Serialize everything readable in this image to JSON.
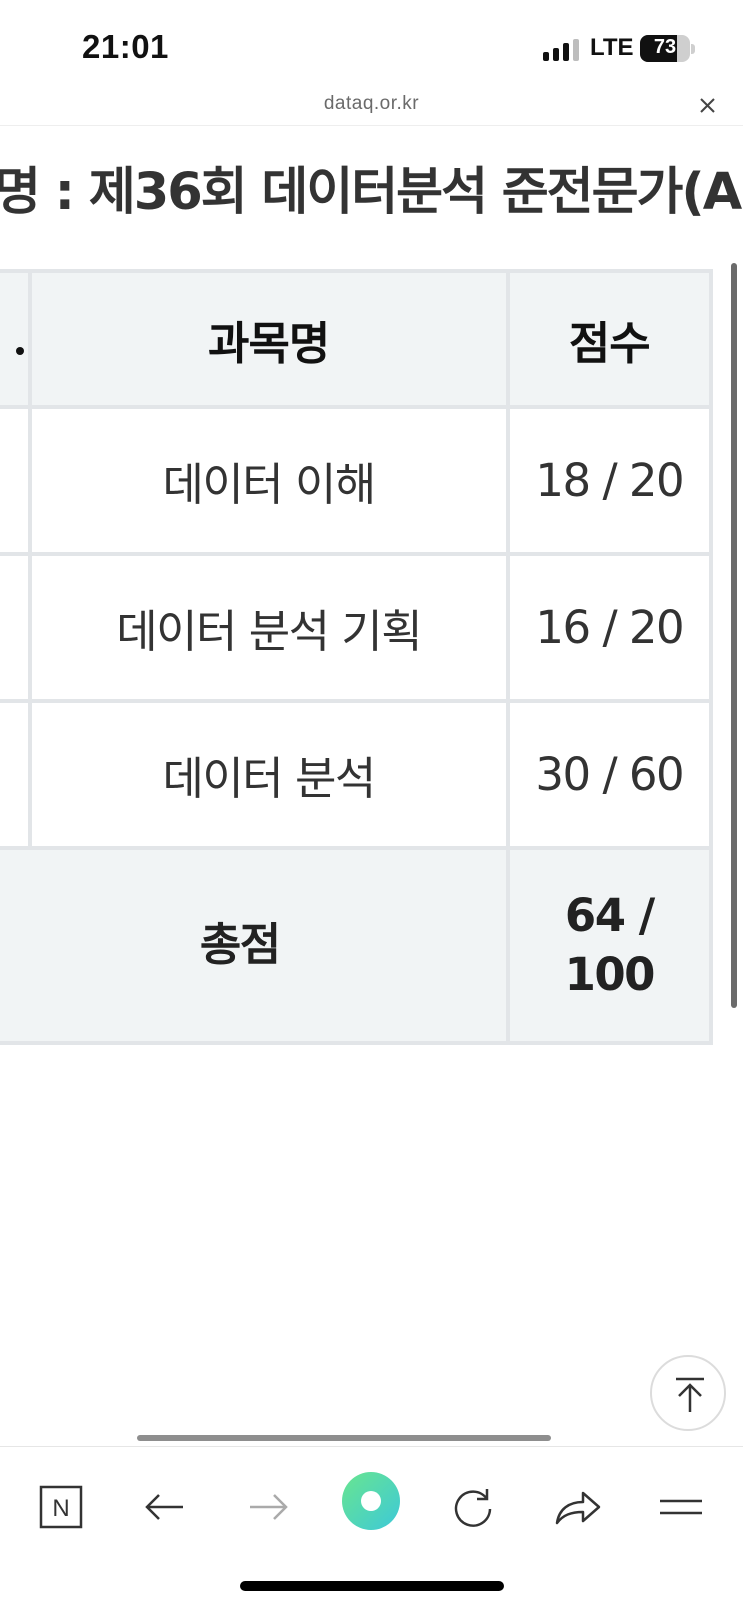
{
  "status_bar": {
    "time": "21:01",
    "network": "LTE",
    "battery": "73",
    "battery_level": 0.73
  },
  "url_bar": {
    "domain": "dataq.or.kr",
    "close_icon": "close-icon"
  },
  "page": {
    "heading": "명 : 제36회 데이터분석 준전문가(A"
  },
  "table": {
    "headers": [
      "과목명",
      "점수"
    ],
    "rows": [
      {
        "subject": "데이터 이해",
        "score": "18 / 20"
      },
      {
        "subject": "데이터 분석 기획",
        "score": "16 / 20"
      },
      {
        "subject": "데이터 분석",
        "score": "30 / 60"
      }
    ],
    "total": {
      "label": "총점",
      "score_line1": "64 /",
      "score_line2": "100"
    }
  },
  "toolbar": {
    "icons": [
      "naver-home-icon",
      "back-arrow-icon",
      "forward-arrow-icon",
      "green-dot-icon",
      "reload-icon",
      "share-icon",
      "menu-icon"
    ],
    "naver_letter": "N",
    "accent_gradient": [
      "#5ee0a0",
      "#3ec9d6"
    ]
  },
  "colors": {
    "header_bg": "#f1f4f5",
    "border": "#e2e5e8",
    "text": "#333333"
  }
}
